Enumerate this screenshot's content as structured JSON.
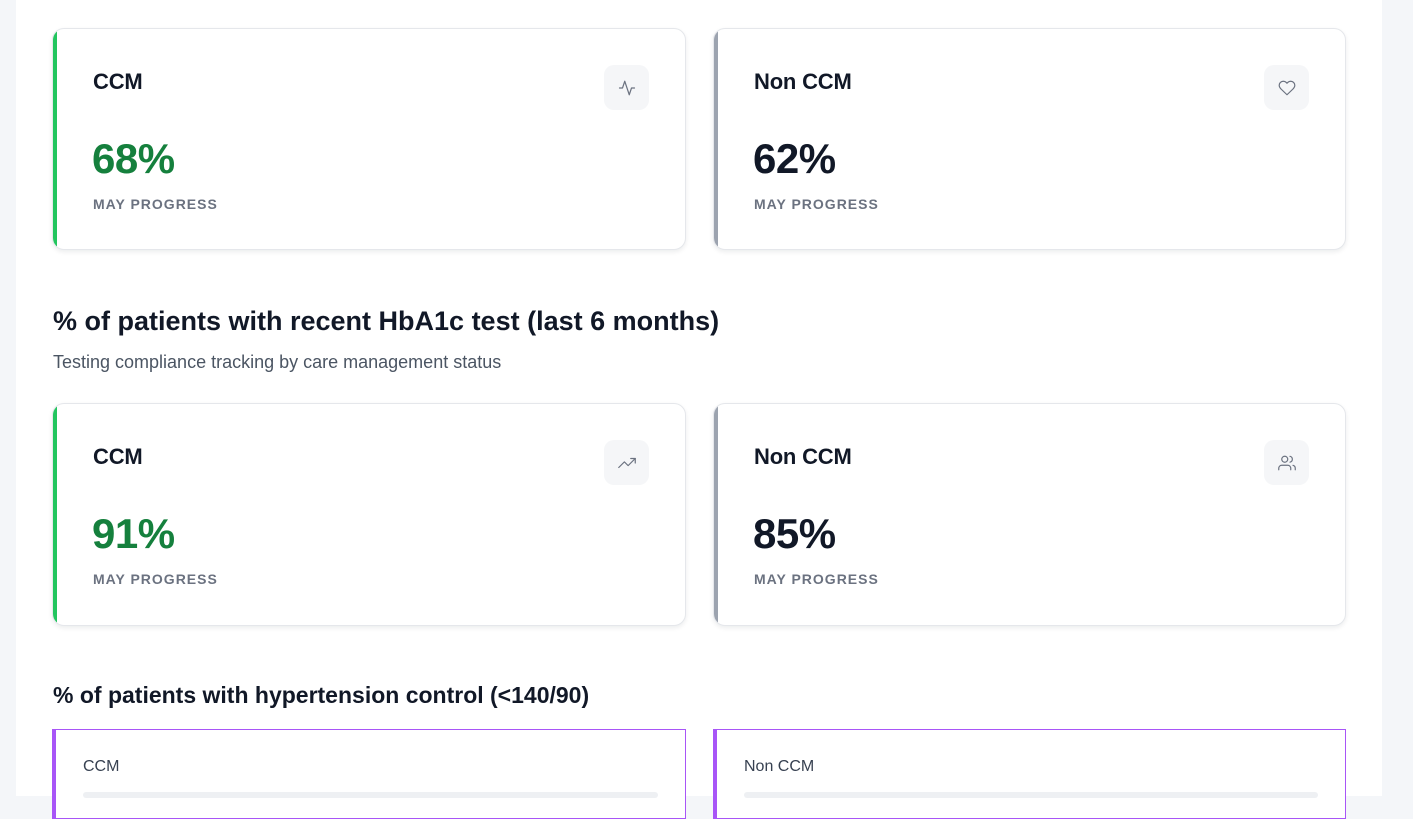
{
  "blood_sugar": {
    "ccm": {
      "title": "CCM",
      "value": "68%",
      "subtitle": "MAY PROGRESS",
      "icon": "activity-icon"
    },
    "non_ccm": {
      "title": "Non CCM",
      "value": "62%",
      "subtitle": "MAY PROGRESS",
      "icon": "heart-icon"
    }
  },
  "hba1c": {
    "title": "% of patients with recent HbA1c test (last 6 months)",
    "subtitle": "Testing compliance tracking by care management status",
    "ccm": {
      "title": "CCM",
      "value": "91%",
      "subtitle": "MAY PROGRESS",
      "icon": "trending-up-icon"
    },
    "non_ccm": {
      "title": "Non CCM",
      "value": "85%",
      "subtitle": "MAY PROGRESS",
      "icon": "users-icon"
    }
  },
  "hypertension": {
    "title": "% of patients with hypertension control (<140/90)",
    "ccm": {
      "label": "CCM"
    },
    "non_ccm": {
      "label": "Non CCM"
    }
  },
  "colors": {
    "ccm_accent": "#22c55e",
    "ccm_value": "#15803d",
    "non_ccm_accent": "#9ca3af",
    "hypertension_accent": "#a855f7"
  }
}
